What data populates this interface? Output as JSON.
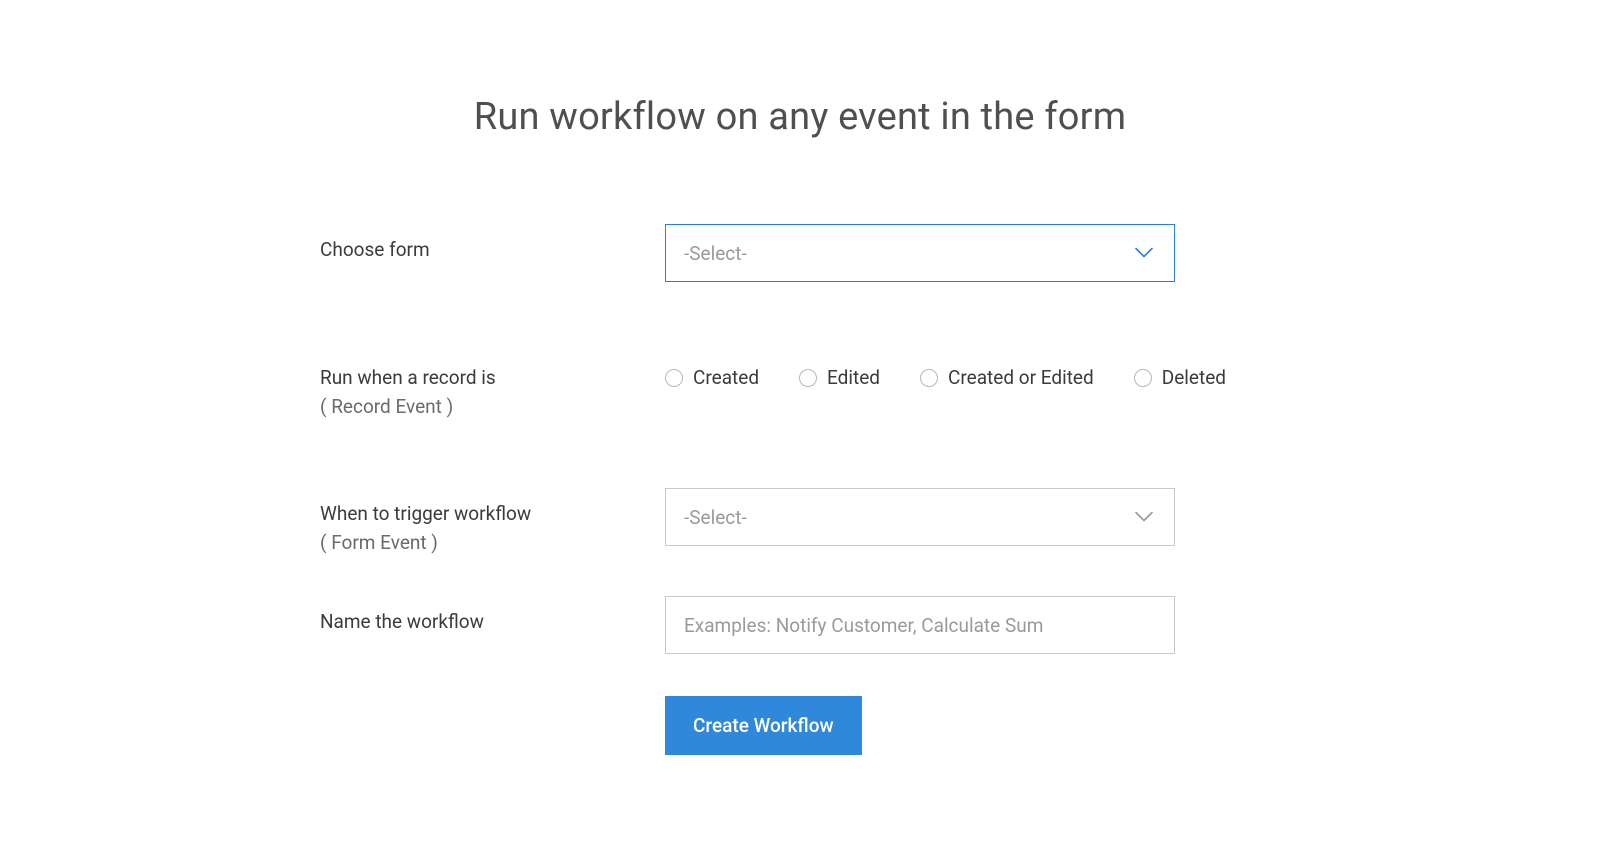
{
  "title": "Run workflow on any event in the form",
  "fields": {
    "choose_form": {
      "label": "Choose form",
      "placeholder": "-Select-"
    },
    "record_event": {
      "label": "Run when a record is",
      "sublabel": "( Record Event )",
      "options": [
        "Created",
        "Edited",
        "Created or Edited",
        "Deleted"
      ]
    },
    "form_event": {
      "label": "When to trigger workflow",
      "sublabel": "( Form Event )",
      "placeholder": "-Select-"
    },
    "name": {
      "label": "Name the workflow",
      "placeholder": "Examples: Notify Customer, Calculate Sum"
    }
  },
  "submit_label": "Create Workflow"
}
